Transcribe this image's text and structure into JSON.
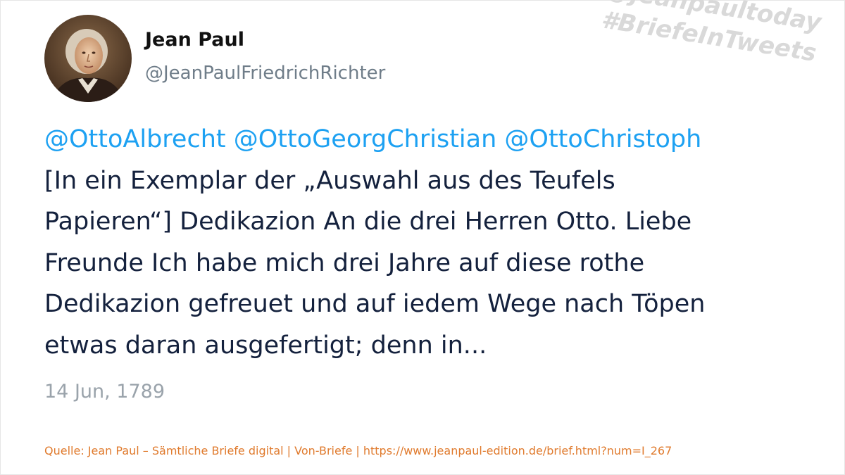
{
  "author": {
    "name": "Jean Paul",
    "handle": "@JeanPaulFriedrichRichter"
  },
  "watermark": {
    "line1": "@jeanpaultoday",
    "line2": "#BriefeInTweets"
  },
  "tweet": {
    "mentions": [
      "@OttoAlbrecht",
      "@OttoGeorgChristian",
      "@OttoChristoph"
    ],
    "lines": [
      "[In ein Exemplar der „Auswahl aus des Teufels",
      "Papieren“] Dedikazion An die drei Herren Otto. Liebe",
      "Freunde Ich habe mich drei Jahre auf diese rothe",
      "Dedikazion gefreuet und auf iedem Wege nach Töpen",
      "etwas daran ausgefertigt; denn in..."
    ],
    "date": "14 Jun, 1789"
  },
  "source": "Quelle: Jean Paul – Sämtliche Briefe digital | Von-Briefe | https://www.jeanpaul-edition.de/brief.html?num=I_267",
  "colors": {
    "mention": "#1da1f2",
    "text": "#14213d",
    "handle": "#6f7d89",
    "date": "#9aa3ab",
    "source": "#e07b2e",
    "watermark": "#d9d9d9"
  },
  "icons": {
    "avatar": "portrait-avatar"
  }
}
